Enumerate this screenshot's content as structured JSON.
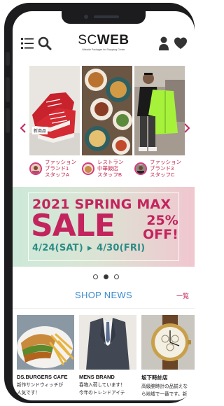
{
  "header": {
    "logo_text": "SC",
    "logo_bold": "WEB",
    "logo_tagline": "Website Packages for Shopping Center"
  },
  "icons": [
    "menu-icon",
    "search-icon",
    "user-icon",
    "heart-icon",
    "chevron-left-icon",
    "chevron-right-icon"
  ],
  "carousel": {
    "cards": [
      {
        "photo": "red sneakers",
        "badge": "新商品",
        "author": "ファッション\nブランド1\nスタッフA"
      },
      {
        "photo": "restaurant dishes",
        "author": "レストラン\n中華飯店\nスタッフB"
      },
      {
        "photo": "neon jacket staff",
        "author": "ファッション\nブランド3\nスタッフC"
      }
    ],
    "dots_total": 3,
    "dots_active": 2
  },
  "banner": {
    "line1": "2021 SPRING MAX",
    "sale": "SALE",
    "discount": "25%",
    "off": "OFF!",
    "date_from": "4/24(SAT)",
    "date_to": "4/30(FRI)",
    "colors": {
      "accent": "#c3245e",
      "dates": "#2b8c86"
    }
  },
  "news": {
    "title": "SHOP NEWS",
    "all_link": "一覧",
    "items": [
      {
        "shop": "DS.BURGERS CAFE",
        "text": "新作サンドウィッチが\n人気です！"
      },
      {
        "shop": "MENS BRAND",
        "text": "春物入荷しています！\n今年のトレンドアイテ"
      },
      {
        "shop": "坂下時計店",
        "text": "高級腕時計の品揃えな\nら地域で一番です。新"
      }
    ]
  }
}
